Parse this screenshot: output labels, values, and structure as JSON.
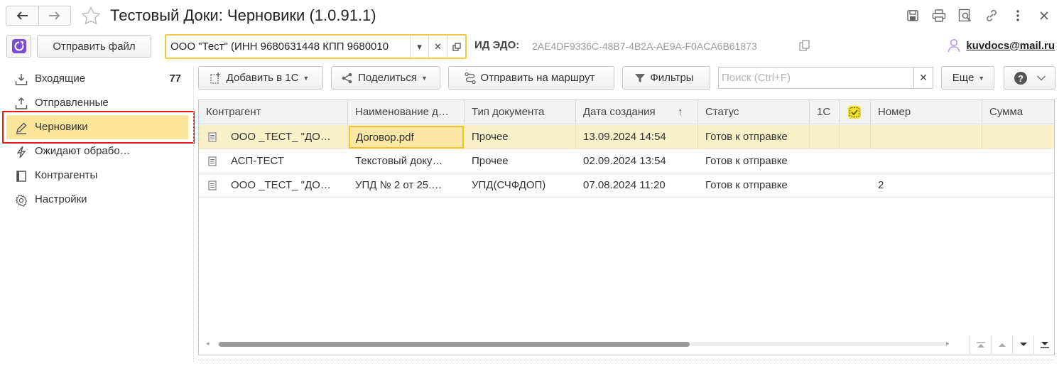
{
  "window": {
    "title": "Тестовый Доки: Черновики (1.0.91.1)"
  },
  "topbar": {
    "send_file_label": "Отправить файл",
    "org_value": "ООО \"Тест\" (ИНН 9680631448 КПП 9680010",
    "edo_label": "ИД ЭДО:",
    "edo_value": "2AE4DF9336C-48B7-4B2A-AE9A-F0ACA6B61873",
    "user_email": "kuvdocs@mail.ru"
  },
  "sidebar": {
    "items": [
      {
        "label": "Входящие",
        "count": "77",
        "icon": "inbox-download-icon"
      },
      {
        "label": "Отправленные",
        "icon": "outbox-upload-icon"
      },
      {
        "label": "Черновики",
        "icon": "pencil-icon",
        "active": true
      },
      {
        "label": "Ожидают обрабо…",
        "icon": "lightning-icon"
      },
      {
        "label": "Контрагенты",
        "icon": "book-icon"
      },
      {
        "label": "Настройки",
        "icon": "gear-icon"
      }
    ]
  },
  "toolbar": {
    "add_1c_label": "Добавить в 1С",
    "share_label": "Поделиться",
    "route_label": "Отправить на маршрут",
    "filters_label": "Фильтры",
    "search_placeholder": "Поиск (Ctrl+F)",
    "more_label": "Еще"
  },
  "table": {
    "columns": {
      "counterparty": "Контрагент",
      "name": "Наименование д…",
      "doc_type": "Тип документа",
      "created": "Дата создания",
      "status": "Статус",
      "c1": "1С",
      "number": "Номер",
      "sum": "Сумма"
    },
    "rows": [
      {
        "counterparty": "ООО _ТЕСТ_ \"ДО…",
        "name": "Договор.pdf",
        "doc_type": "Прочее",
        "created": "13.09.2024 14:54",
        "status": "Готов к отправке",
        "number": ""
      },
      {
        "counterparty": "АСП-ТЕСТ",
        "name": "Текстовый доку…",
        "doc_type": "Прочее",
        "created": "02.09.2024 13:54",
        "status": "Готов к отправке",
        "number": ""
      },
      {
        "counterparty": "ООО _ТЕСТ_ \"ДО…",
        "name": "УПД № 2 от 25.…",
        "doc_type": "УПД(СЧФДОП)",
        "created": "07.08.2024 11:20",
        "status": "Готов к отправке",
        "number": "2"
      }
    ],
    "scroll_position": 0.64
  },
  "colors": {
    "accent_yellow": "#f5c842",
    "active_item_bg": "#fbe59a",
    "selected_row_bg": "#fbf1c9",
    "highlight_red": "#e11d1d",
    "app_icon_purple": "#7b4dd6"
  }
}
